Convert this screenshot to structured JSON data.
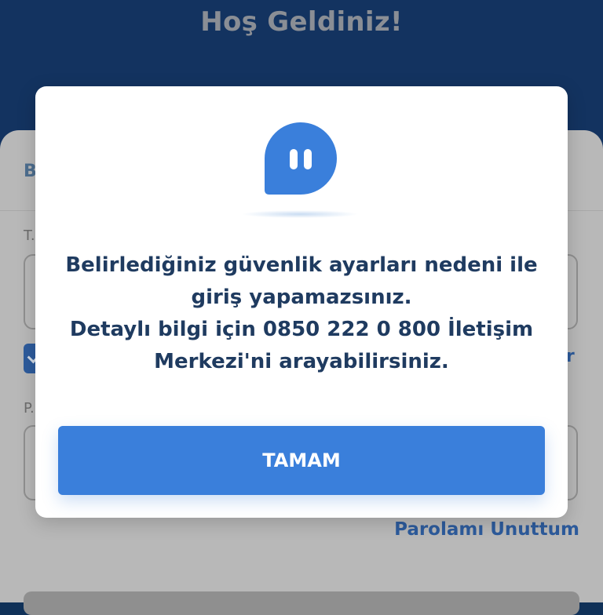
{
  "header": {
    "title": "Hoş Geldiniz!"
  },
  "login_form": {
    "tab_label_partial": "B",
    "field1_label_partial": "T.",
    "field2_label_partial": "P.",
    "right_link_partial": "ar",
    "forgot_password_link": "Parolamı Unuttum"
  },
  "dialog": {
    "icon": "chat-bubble-pause-icon",
    "message": "Belirlediğiniz güvenlik ayarları nedeni ile\ngiriş yapamazsınız.\nDetaylı bilgi için 0850 222 0 800 İletişim\nMerkezi'ni arayabilirsiniz.",
    "button_label": "TAMAM"
  },
  "colors": {
    "accent": "#3a7fdb",
    "header_bg": "#133360",
    "text_dark": "#1f3b60"
  }
}
